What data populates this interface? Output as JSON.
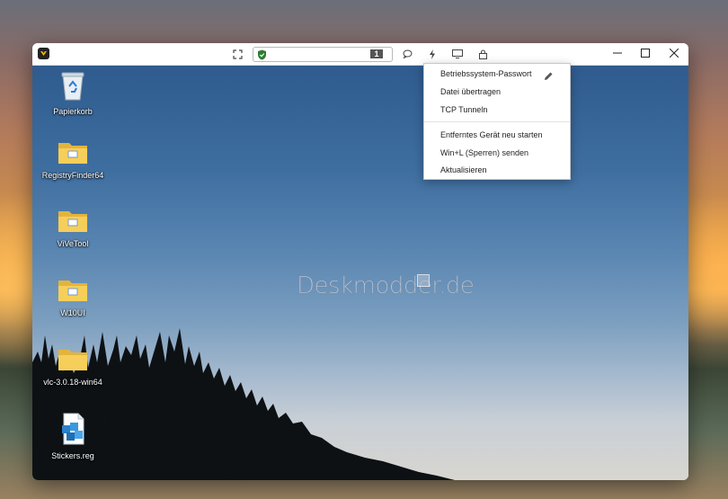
{
  "window": {
    "address_badge": "1",
    "toolbar_icons": [
      "fullscreen-icon",
      "shield-icon",
      "chat-icon",
      "lightning-icon",
      "monitor-icon",
      "lock-icon"
    ],
    "controls": [
      "minimize",
      "maximize",
      "close"
    ]
  },
  "desktop_icons": [
    {
      "label": "Papierkorb",
      "icon": "recycle-bin-icon"
    },
    {
      "label": "RegistryFinder64",
      "icon": "folder-icon"
    },
    {
      "label": "ViVeTool",
      "icon": "folder-icon"
    },
    {
      "label": "W10UI",
      "icon": "folder-icon"
    },
    {
      "label": "vlc-3.0.18-win64",
      "icon": "folder-icon"
    },
    {
      "label": "Stickers.reg",
      "icon": "registry-file-icon"
    }
  ],
  "watermark": "Deskmodder.de",
  "menu": {
    "items": [
      {
        "label": "Betriebssystem-Passwort"
      },
      {
        "label": "Datei übertragen"
      },
      {
        "label": "TCP Tunneln"
      },
      {
        "label": "Entferntes Gerät neu starten"
      },
      {
        "label": "Win+L (Sperren) senden"
      },
      {
        "label": "Aktualisieren"
      }
    ]
  },
  "colors": {
    "accent_green": "#2e7d32",
    "titlebar": "#ffffff"
  }
}
